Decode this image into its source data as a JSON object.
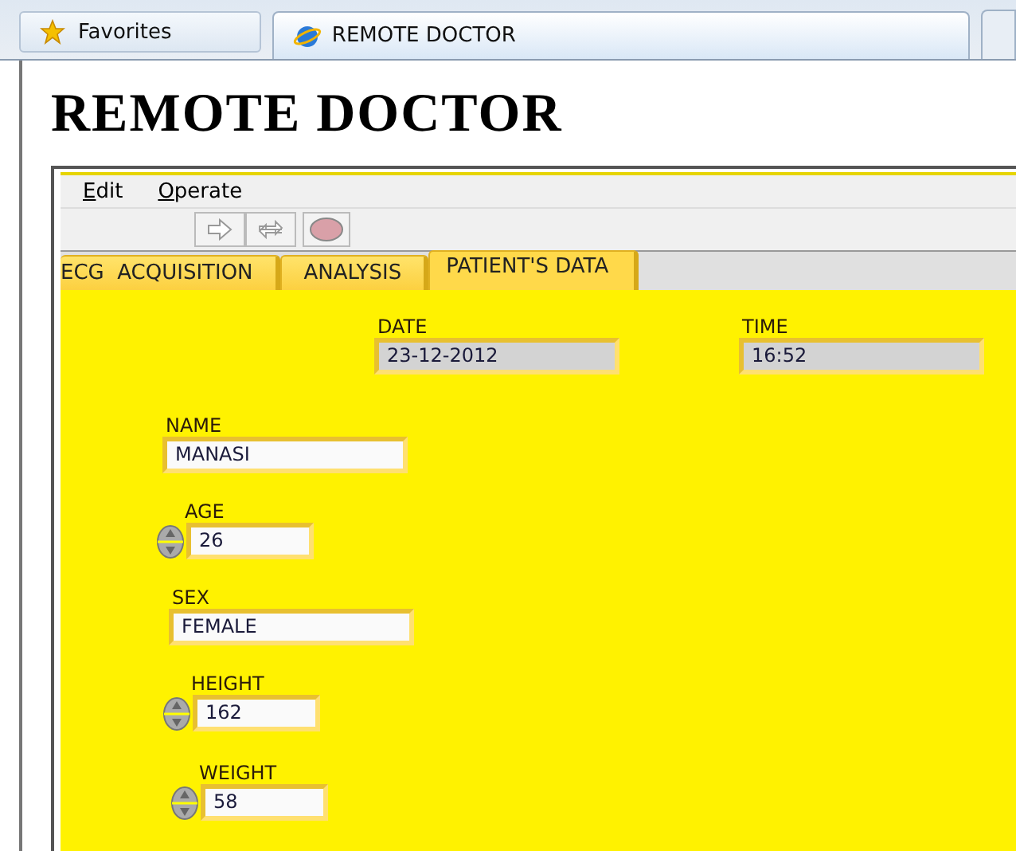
{
  "browser_bar": {
    "favorites": "Favorites",
    "tabs": [
      {
        "title": "REMOTE DOCTOR",
        "selected": true
      }
    ]
  },
  "page_title": "REMOTE DOCTOR",
  "menu": [
    {
      "label": "Edit",
      "mnemonic_underlined": true
    },
    {
      "label": "Operate",
      "mnemonic_underlined": true
    }
  ],
  "tabs": [
    {
      "label": "ECG  ACQUISITION",
      "selected": false
    },
    {
      "label": "ANALYSIS",
      "selected": false
    },
    {
      "label": "PATIENT'S DATA",
      "selected": true
    }
  ],
  "fields": [
    {
      "label": "DATE",
      "value": "23-12-2012",
      "kind": "indicator"
    },
    {
      "label": "TIME",
      "value": "16:52",
      "kind": "indicator"
    },
    {
      "label": "NAME",
      "value": "MANASI",
      "kind": "text"
    },
    {
      "label": "AGE",
      "value": "26",
      "kind": "numeric"
    },
    {
      "label": "SEX",
      "value": "FEMALE",
      "kind": "text"
    },
    {
      "label": "HEIGHT",
      "value": "162",
      "kind": "numeric"
    },
    {
      "label": "WEIGHT",
      "value": "58",
      "kind": "numeric"
    }
  ]
}
